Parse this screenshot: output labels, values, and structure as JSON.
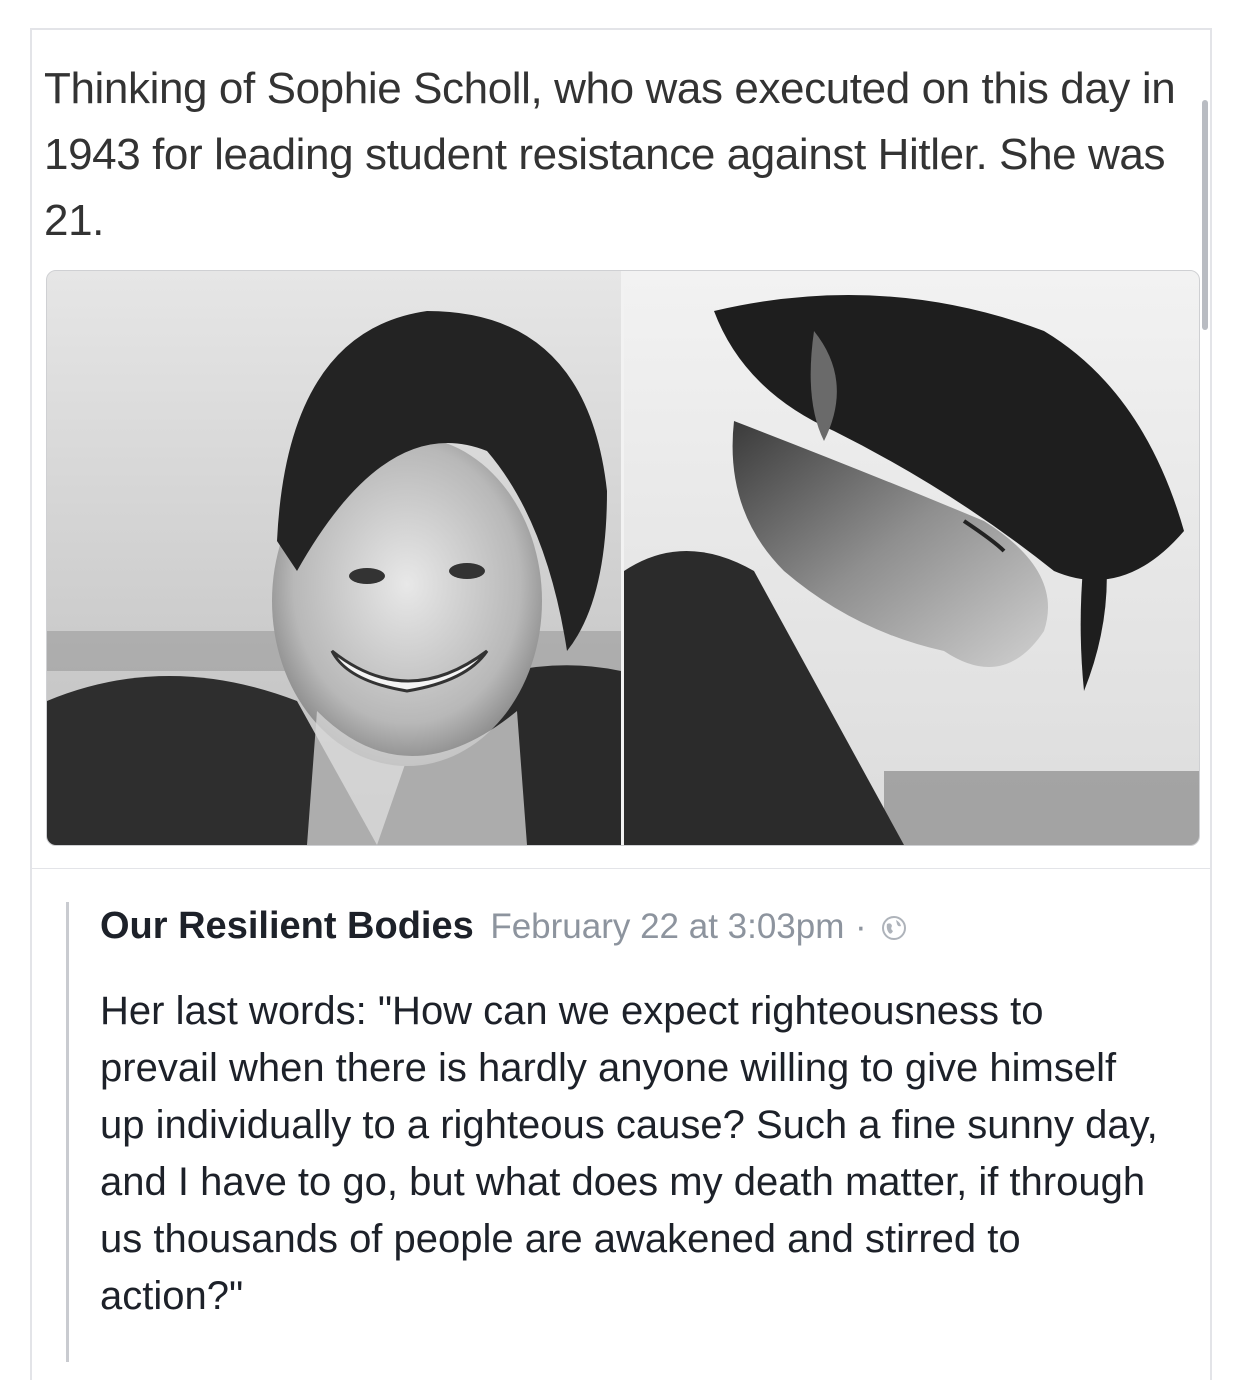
{
  "post": {
    "text": "Thinking of Sophie Scholl, who was executed on this day in 1943 for leading student resistance against Hitler. She was 21."
  },
  "shared": {
    "page_name": "Our Resilient Bodies",
    "timestamp": "February 22 at 3:03pm",
    "separator": "·",
    "privacy_icon": "globe-icon",
    "quote": "Her last words: \"How can we expect righteousness to prevail when there is hardly anyone willing to give himself up individually to a righteous cause? Such a fine sunny day, and I have to go, but what does my death matter, if through us thousands of people are awakened and stirred to action?\""
  },
  "colors": {
    "name_text": "#1d2129",
    "meta_text": "#8d949e",
    "post_text": "#333333"
  }
}
